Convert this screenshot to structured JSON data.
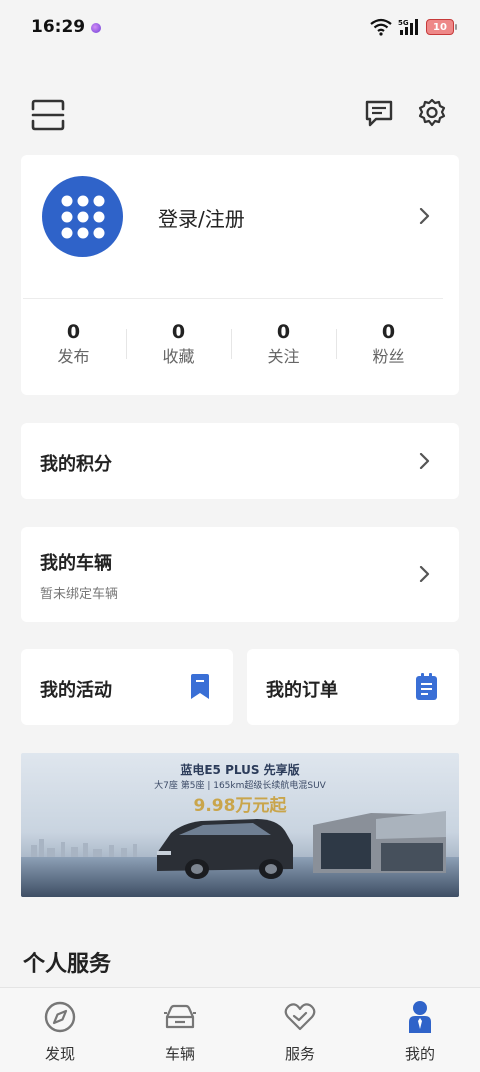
{
  "status_bar": {
    "time": "16:29",
    "network": "5G",
    "battery": "10"
  },
  "top_actions": {
    "scan_icon": "scan-icon",
    "message_icon": "message-icon",
    "settings_icon": "gear-icon"
  },
  "profile": {
    "login_label": "登录/注册",
    "stats": [
      {
        "value": "0",
        "label": "发布"
      },
      {
        "value": "0",
        "label": "收藏"
      },
      {
        "value": "0",
        "label": "关注"
      },
      {
        "value": "0",
        "label": "粉丝"
      }
    ]
  },
  "points": {
    "title": "我的积分"
  },
  "vehicle": {
    "title": "我的车辆",
    "subtitle": "暂未绑定车辆"
  },
  "activity": {
    "title": "我的活动"
  },
  "orders": {
    "title": "我的订单"
  },
  "banner": {
    "title": "蓝电E5 PLUS 先享版",
    "subtitle": "大7座 第5座 | 165km超级长续航电混SUV",
    "price": "9.98万元起"
  },
  "section": {
    "title": "个人服务"
  },
  "tabs": [
    {
      "label": "发现",
      "icon": "compass-icon",
      "active": false
    },
    {
      "label": "车辆",
      "icon": "car-icon",
      "active": false
    },
    {
      "label": "服务",
      "icon": "heart-check-icon",
      "active": false
    },
    {
      "label": "我的",
      "icon": "person-icon",
      "active": true
    }
  ],
  "colors": {
    "accent": "#2f63c9",
    "background": "#f4f4f4",
    "card": "#ffffff",
    "icon_blue": "#3a6fd6"
  }
}
